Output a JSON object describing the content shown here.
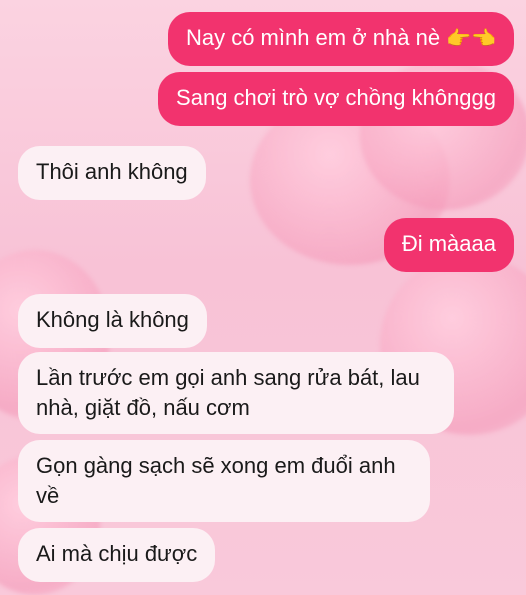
{
  "messages": [
    {
      "side": "sent",
      "text": "Nay có mình em ở nhà nè",
      "emoji": "👉👈"
    },
    {
      "side": "sent",
      "text": "Sang chơi trò vợ chồng khônggg"
    },
    {
      "side": "received",
      "text": "Thôi anh không"
    },
    {
      "side": "sent",
      "text": "Đi màaaa"
    },
    {
      "side": "received",
      "text": "Không là không"
    },
    {
      "side": "received",
      "text": "Lần trước em gọi anh sang rửa bát, lau nhà, giặt đồ, nấu cơm"
    },
    {
      "side": "received",
      "text": "Gọn gàng sạch sẽ xong em đuổi anh về"
    },
    {
      "side": "received",
      "text": "Ai mà chịu được"
    }
  ],
  "colors": {
    "sent_bubble": "#f2336e",
    "received_bubble": "#fcf0f4",
    "background": "#f9c6d8"
  }
}
